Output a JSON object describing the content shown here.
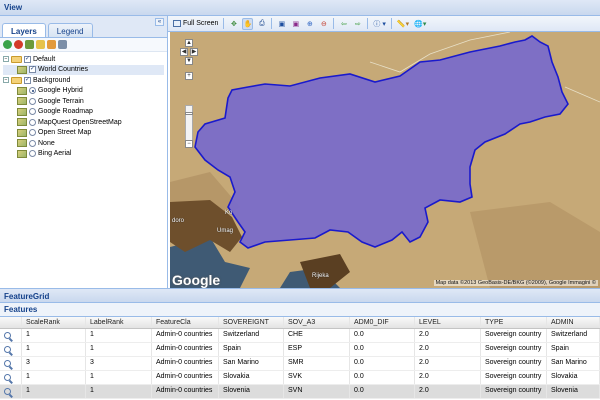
{
  "view_title": "View",
  "tabs": [
    "Layers",
    "Legend"
  ],
  "tree": {
    "default_group": "Default",
    "world_countries": "World Countries",
    "background_group": "Background",
    "base_layers": [
      {
        "label": "Google Hybrid",
        "selected": true
      },
      {
        "label": "Google Terrain",
        "selected": false
      },
      {
        "label": "Google Roadmap",
        "selected": false
      },
      {
        "label": "MapQuest OpenStreetMap",
        "selected": false
      },
      {
        "label": "Open Street Map",
        "selected": false
      },
      {
        "label": "None",
        "selected": false
      },
      {
        "label": "Bing Aerial",
        "selected": false
      }
    ]
  },
  "toolbar": {
    "full_screen": "Full Screen"
  },
  "map": {
    "google_logo": "Google",
    "attribution": "Map data ©2013 GeoBasis-DE/BKG (©2009), Google Immagini ©",
    "places": [
      "Umag",
      "Rijeka",
      "Ko",
      "doro"
    ],
    "fill_color": "#7a6bc9",
    "outline_color": "#1a1acc",
    "terrain_color": "#c6a977"
  },
  "feature_grid_title": "FeatureGrid",
  "features_title": "Features",
  "grid": {
    "columns": [
      "",
      "ScaleRank",
      "LabelRank",
      "FeatureCla",
      "SOVEREIGNT",
      "SOV_A3",
      "ADM0_DIF",
      "LEVEL",
      "TYPE",
      "ADMIN"
    ],
    "rows": [
      [
        "1",
        "1",
        "Admin-0 countries",
        "Switzerland",
        "CHE",
        "0.0",
        "2.0",
        "Sovereign country",
        "Switzerland"
      ],
      [
        "1",
        "1",
        "Admin-0 countries",
        "Spain",
        "ESP",
        "0.0",
        "2.0",
        "Sovereign country",
        "Spain"
      ],
      [
        "3",
        "3",
        "Admin-0 countries",
        "San Marino",
        "SMR",
        "0.0",
        "2.0",
        "Sovereign country",
        "San Marino"
      ],
      [
        "1",
        "1",
        "Admin-0 countries",
        "Slovakia",
        "SVK",
        "0.0",
        "2.0",
        "Sovereign country",
        "Slovakia"
      ],
      [
        "1",
        "1",
        "Admin-0 countries",
        "Slovenia",
        "SVN",
        "0.0",
        "2.0",
        "Sovereign country",
        "Slovenia"
      ]
    ],
    "selected_row": 4
  }
}
